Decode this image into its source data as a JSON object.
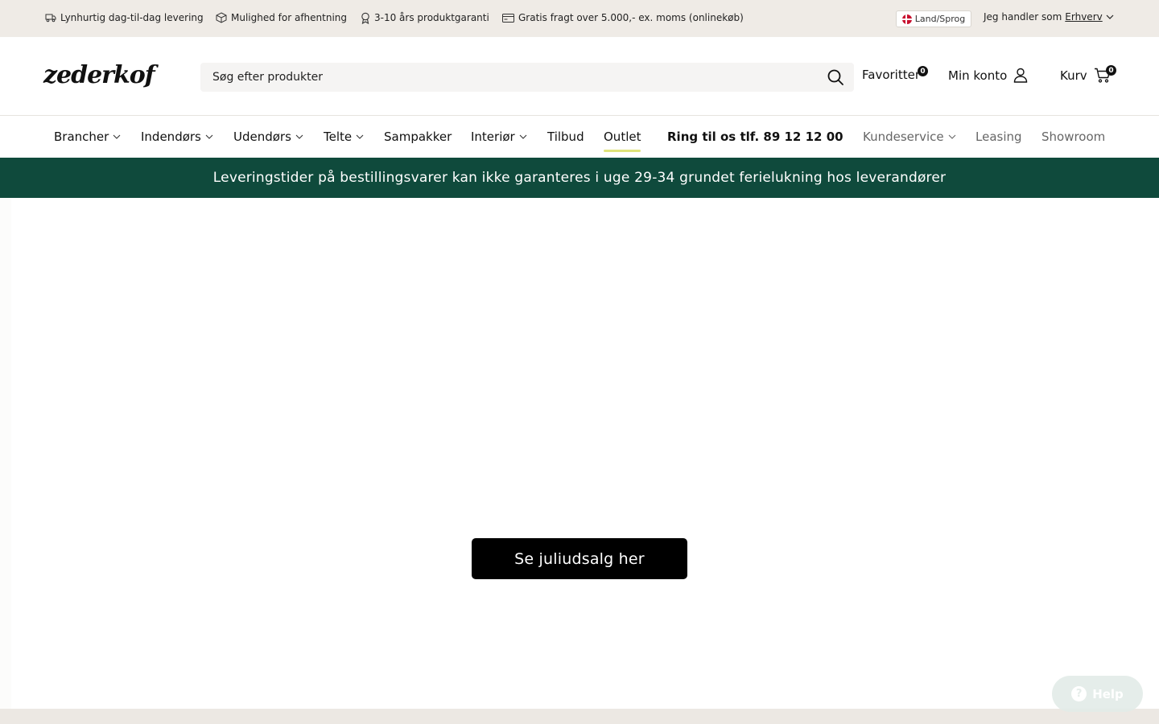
{
  "topbar": {
    "usps": [
      {
        "icon": "truck-icon",
        "label": "Lynhurtig dag-til-dag levering"
      },
      {
        "icon": "box-icon",
        "label": "Mulighed for afhentning"
      },
      {
        "icon": "award-icon",
        "label": "3-10 års produktgaranti"
      },
      {
        "icon": "card-icon",
        "label": "Gratis fragt over 5.000,- ex. moms (onlinekøb)"
      }
    ],
    "lang_label": "Land/Sprog",
    "shopper_prefix": "Jeg handler som",
    "shopper_type": "Erhverv"
  },
  "header": {
    "logo_text": "zederkof",
    "search_placeholder": "Søg efter produkter",
    "favorites_label": "Favoritter",
    "favorites_count": "0",
    "account_label": "Min konto",
    "cart_label": "Kurv",
    "cart_count": "0"
  },
  "nav": {
    "items": [
      {
        "label": "Brancher",
        "dropdown": true
      },
      {
        "label": "Indendørs",
        "dropdown": true
      },
      {
        "label": "Udendørs",
        "dropdown": true
      },
      {
        "label": "Telte",
        "dropdown": true
      },
      {
        "label": "Sampakker",
        "dropdown": false
      },
      {
        "label": "Interiør",
        "dropdown": true
      },
      {
        "label": "Tilbud",
        "dropdown": false
      },
      {
        "label": "Outlet",
        "dropdown": false,
        "active": true
      }
    ],
    "phone": "Ring til os tlf. 89 12 12 00",
    "secondary": [
      {
        "label": "Kundeservice",
        "dropdown": true
      },
      {
        "label": "Leasing",
        "dropdown": false
      },
      {
        "label": "Showroom",
        "dropdown": false
      }
    ]
  },
  "banner": {
    "text": "Leveringstider på bestillingsvarer kan ikke garanteres i uge 29-34 grundet ferielukning hos leverandører",
    "bg": "#0f4a3c"
  },
  "hero": {
    "cta_label": "Se juliudsalg her"
  },
  "help": {
    "label": "Help"
  }
}
